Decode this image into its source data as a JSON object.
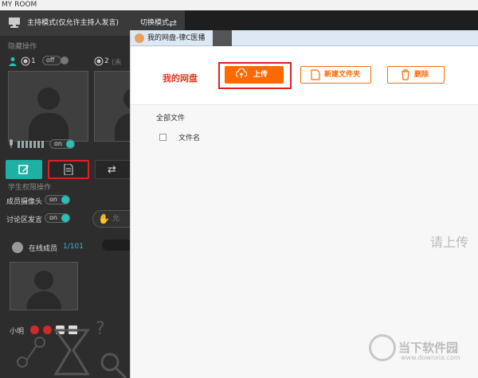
{
  "app": {
    "title": "MY ROOM"
  },
  "mode_bar": {
    "label": "主持模式(仅允许主持人发言)",
    "switch_label": "切换模式"
  },
  "sections": {
    "hidden_ops": "隐藏操作",
    "student_permissions": "学生权限操作"
  },
  "presenter": {
    "slot1_number": "1",
    "slot1_state": "off",
    "slot2_number": "2",
    "slot2_status": "(未"
  },
  "audio": {
    "mic_toggle": "on"
  },
  "permissions": [
    {
      "label": "成员摄像头",
      "toggle": "on"
    },
    {
      "label": "讨论区发言",
      "toggle": "on"
    }
  ],
  "allow_button": "允",
  "members": {
    "label": "在线成员",
    "count": "1/101",
    "first_member_name": "小明"
  },
  "dialog": {
    "title": "我的网盘-律C医播",
    "heading": "我的网盘",
    "upload_label": "上传",
    "new_folder_label": "新建文件夹",
    "delete_label": "删除",
    "all_files_label": "全部文件",
    "filename_column": "文件名",
    "empty_hint": "请上传"
  },
  "watermark": {
    "cn": "当下软件园",
    "url": "www.downxia.com"
  },
  "colors": {
    "accent_orange": "#ff6a00",
    "teal": "#1fb0a4",
    "highlight_red": "#e02020"
  },
  "icons": [
    "user-icon",
    "radio-icon",
    "mic-icon",
    "edit-icon",
    "document-icon",
    "swap-icon",
    "upload-cloud-icon",
    "new-folder-icon",
    "trash-icon",
    "hand-icon",
    "mic-muted-icon",
    "camera-off-icon",
    "chat-icon",
    "mail-icon"
  ]
}
